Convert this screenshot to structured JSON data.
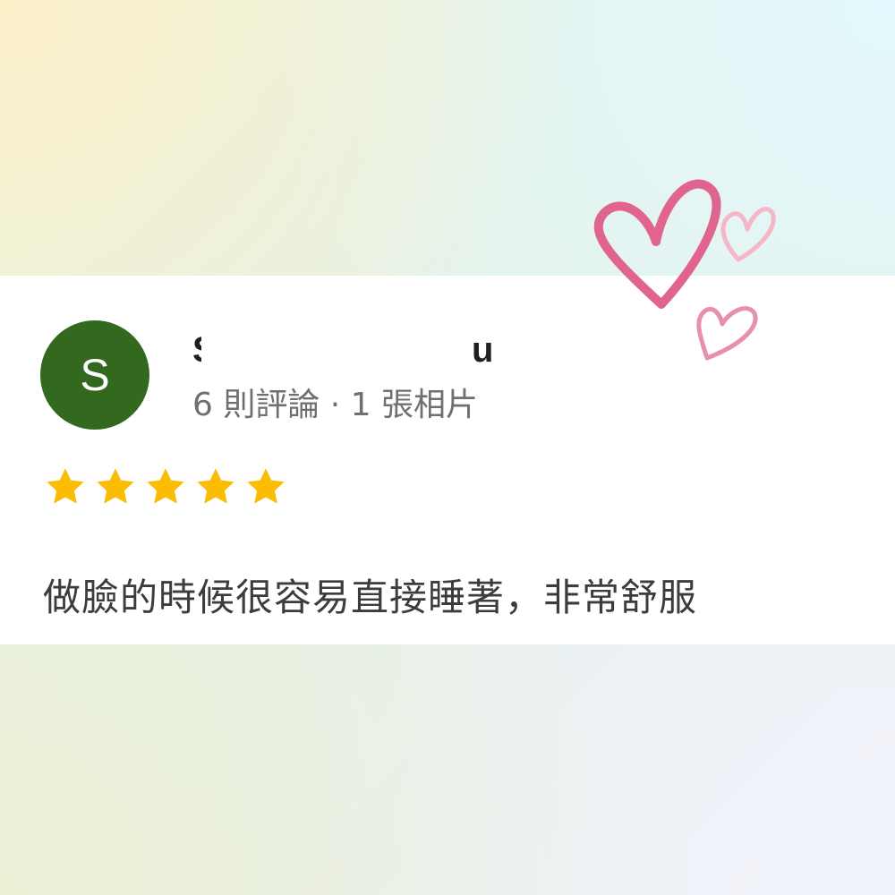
{
  "review": {
    "avatar_initial": "S",
    "avatar_color": "#33691e",
    "author_name_start": "S",
    "author_name_end": "u",
    "author_meta": "6 則評論 · 1 張相片",
    "rating": 5,
    "star_color": "#fbbc04",
    "text": "做臉的時候很容易直接睡著，非常舒服"
  },
  "decoration": {
    "icon": "hearts-doodle-icon",
    "colors": [
      "#e0648d",
      "#f5b7c8",
      "#e890ab"
    ]
  }
}
